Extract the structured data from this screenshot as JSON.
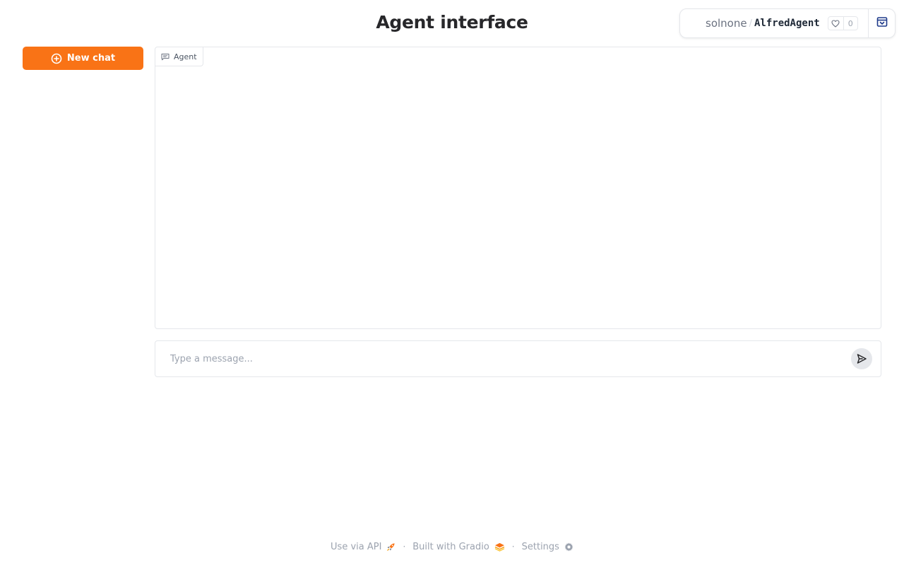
{
  "header": {
    "title": "Agent interface"
  },
  "space": {
    "owner": "solnone",
    "separator": "/",
    "name": "AlfredAgent",
    "likes": "0"
  },
  "sidebar": {
    "new_chat_label": "New chat"
  },
  "chatbot": {
    "label": "Agent"
  },
  "composer": {
    "placeholder": "Type a message..."
  },
  "footer": {
    "api_label": "Use via API",
    "built_label": "Built with Gradio",
    "settings_label": "Settings",
    "separator": "·"
  },
  "colors": {
    "accent": "#f97316",
    "border": "#e5e7eb",
    "muted_text": "#9ca3af"
  },
  "icons": {
    "new_chat": "plus-circle-icon",
    "chatbot_label": "chat-bubble-icon",
    "send": "send-icon",
    "like": "heart-icon",
    "collapse": "collapse-window-icon",
    "api": "rocket-icon",
    "gradio": "gradio-logo-icon",
    "settings": "gear-icon"
  }
}
